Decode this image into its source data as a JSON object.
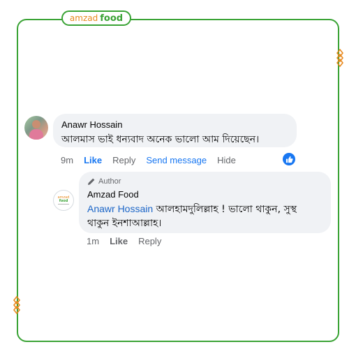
{
  "brand": {
    "part1": "amzad",
    "part2": "food"
  },
  "comment": {
    "author": "Anawr Hossain",
    "text": "আলমাস ভাই ধন্যবাদ অনেক ভালো আম দিয়েছেন।",
    "actions": {
      "time": "9m",
      "like": "Like",
      "reply": "Reply",
      "send_message": "Send message",
      "hide": "Hide"
    }
  },
  "reply": {
    "badge": "Author",
    "author": "Amzad Food",
    "mention": "Anawr Hossain",
    "text_line1": " আলহামদুলিল্লাহ ! ভালো থাকুন, সুস্থ",
    "text_line2": "থাকুন ইনশাআল্লাহ।",
    "actions": {
      "time": "1m",
      "like": "Like",
      "reply": "Reply"
    }
  },
  "logo_small": {
    "part1": "amzad",
    "part2": "food"
  },
  "colors": {
    "frame": "#3aa335",
    "brand_orange": "#e8891e",
    "facebook_blue": "#1877f2",
    "bubble": "#f0f2f5",
    "muted": "#65676b"
  },
  "icons": [
    "pencil-icon",
    "thumbs-up-icon",
    "chain-decoration-icon"
  ]
}
